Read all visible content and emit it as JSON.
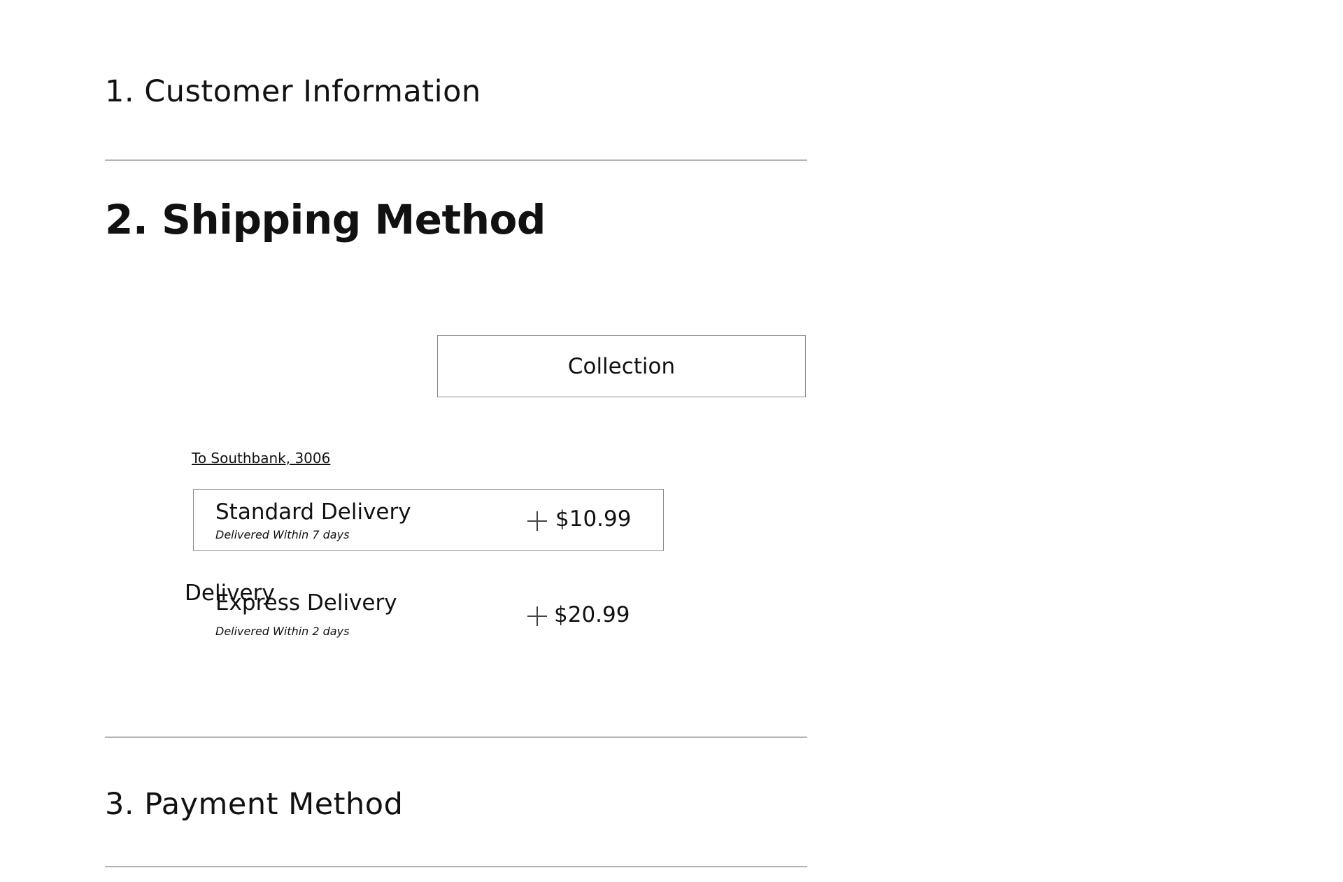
{
  "sections": {
    "customer": {
      "title": "1. Customer Information"
    },
    "shipping": {
      "title": "2. Shipping Method"
    },
    "payment": {
      "title": "3. Payment Method"
    }
  },
  "shipping": {
    "collection_label": "Collection",
    "delivery_label": "Delivery",
    "location_link": "To Southbank, 3006",
    "options": [
      {
        "name": "Standard Delivery",
        "subtitle": "Delivered Within 7 days",
        "price": "$10.99",
        "selected": true
      },
      {
        "name": "Express Delivery",
        "subtitle": "Delivered Within 2 days",
        "price": "$20.99",
        "selected": false
      }
    ]
  },
  "icons": {
    "add": "plus-icon"
  },
  "colors": {
    "text": "#111111",
    "border": "#8a8a8a",
    "divider": "#b3b3b3",
    "background": "#ffffff"
  }
}
